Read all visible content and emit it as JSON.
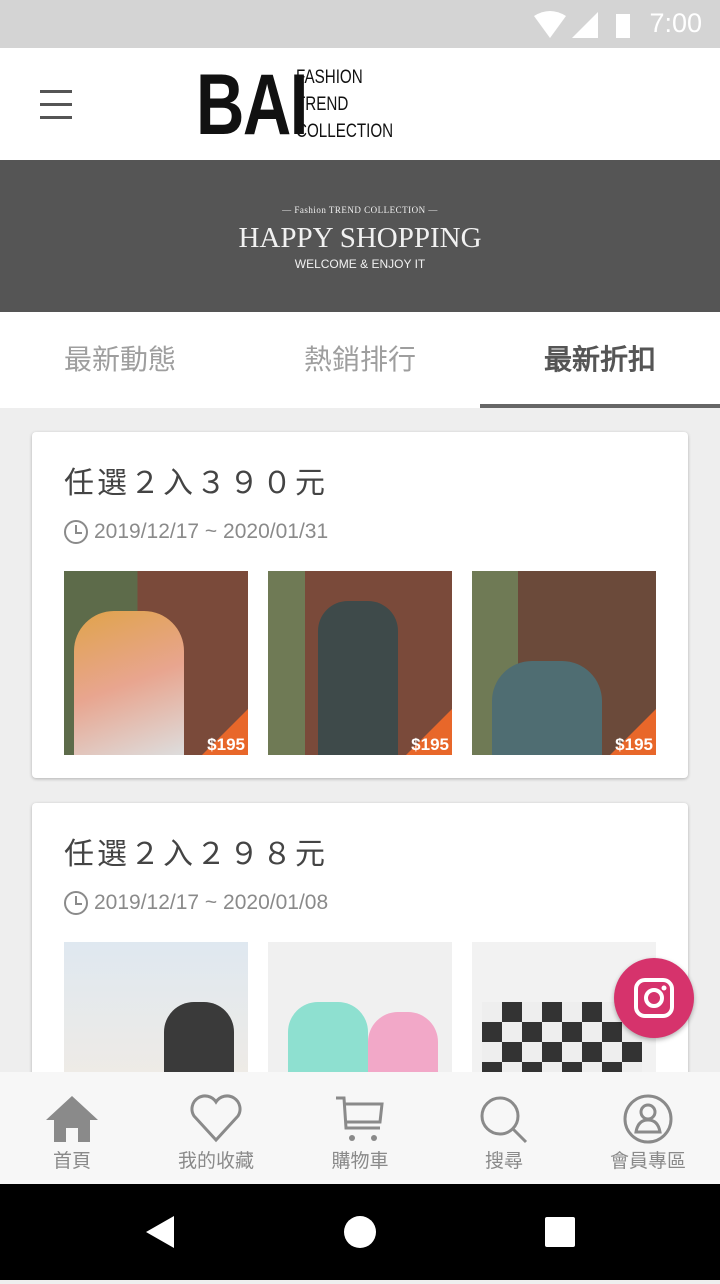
{
  "status_bar": {
    "time": "7:00"
  },
  "header": {
    "logo_main": "BAI",
    "logo_lines": [
      "FASHION",
      "TREND",
      "COLLECTION"
    ]
  },
  "banner": {
    "subtitle": "— Fashion TREND COLLECTION —",
    "title": "HAPPY SHOPPING",
    "tagline": "WELCOME & ENJOY IT"
  },
  "tabs": [
    {
      "label": "最新動態"
    },
    {
      "label": "熱銷排行"
    },
    {
      "label": "最新折扣",
      "active": true
    }
  ],
  "promotions": [
    {
      "title": "任選２入３９０元",
      "date": "2019/12/17 ~ 2020/01/31",
      "images": [
        {
          "price": "$195",
          "colors": [
            "#5d6b4a",
            "#e8a58f"
          ]
        },
        {
          "price": "$195",
          "colors": [
            "#7a4a3a",
            "#3e4a4a"
          ]
        },
        {
          "price": "$195",
          "colors": [
            "#6b4a3a",
            "#4f6d72"
          ]
        }
      ]
    },
    {
      "title": "任選２入２９８元",
      "date": "2019/12/17 ~ 2020/01/08",
      "images": [
        {
          "colors": [
            "#dfe8f0",
            "#3a3a3a"
          ]
        },
        {
          "colors": [
            "#f0f0f0",
            "#8ee0d0"
          ]
        },
        {
          "colors": [
            "#f2f2f2",
            "#333333"
          ]
        }
      ]
    }
  ],
  "bottom_nav": [
    {
      "label": "首頁",
      "icon": "home-icon"
    },
    {
      "label": "我的收藏",
      "icon": "heart-icon"
    },
    {
      "label": "購物車",
      "icon": "cart-icon"
    },
    {
      "label": "搜尋",
      "icon": "search-icon"
    },
    {
      "label": "會員專區",
      "icon": "user-icon"
    }
  ],
  "fab": {
    "icon": "instagram-icon",
    "color": "#d6336c"
  }
}
